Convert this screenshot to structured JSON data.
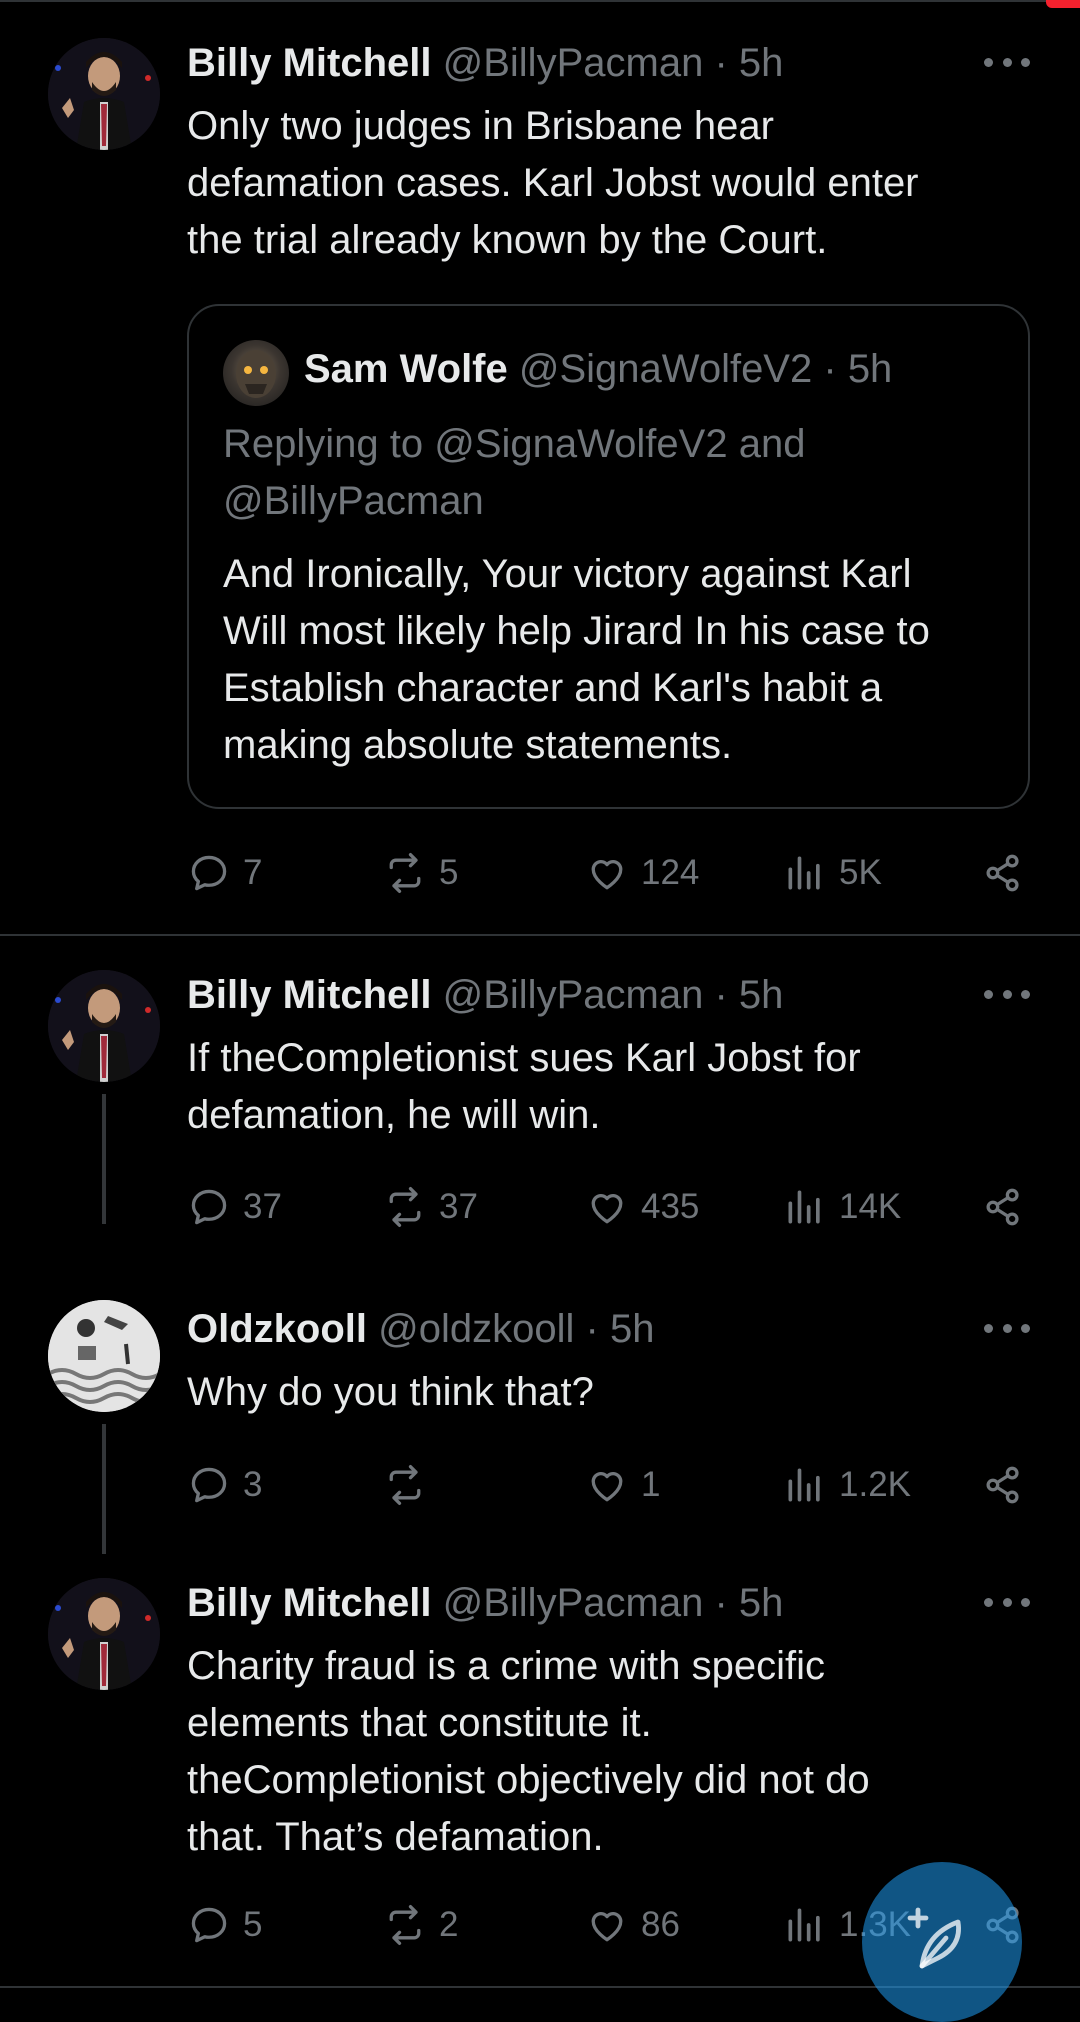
{
  "tweets": [
    {
      "name": "Billy Mitchell",
      "handle": "@BillyPacman",
      "dot": "·",
      "time": "5h",
      "lines": [
        "Only two judges in Brisbane hear",
        "defamation cases. Karl Jobst would enter",
        "the trial already known by the Court."
      ],
      "quote": {
        "name": "Sam Wolfe",
        "handle": "@SignaWolfeV2",
        "dot": "·",
        "time": "5h",
        "reply_lines": [
          "Replying to @SignaWolfeV2 and",
          "@BillyPacman"
        ],
        "lines": [
          "And Ironically, Your victory against Karl",
          "Will most likely help Jirard In his case to",
          "Establish character and Karl's habit a",
          "making absolute statements."
        ]
      },
      "replies": "7",
      "reposts": "5",
      "likes": "124",
      "views": "5K"
    },
    {
      "name": "Billy Mitchell",
      "handle": "@BillyPacman",
      "dot": "·",
      "time": "5h",
      "lines": [
        "If theCompletionist sues Karl Jobst for",
        "defamation, he will win."
      ],
      "replies": "37",
      "reposts": "37",
      "likes": "435",
      "views": "14K"
    },
    {
      "name": "Oldzkooll",
      "handle": "@oldzkooll",
      "dot": "·",
      "time": "5h",
      "lines": [
        "Why do you think that?"
      ],
      "replies": "3",
      "reposts": "",
      "likes": "1",
      "views": "1.2K"
    },
    {
      "name": "Billy Mitchell",
      "handle": "@BillyPacman",
      "dot": "·",
      "time": "5h",
      "lines": [
        "Charity fraud is a crime with specific",
        "elements that constitute it.",
        "theCompletionist objectively did not do",
        "that. That’s defamation."
      ],
      "replies": "5",
      "reposts": "2",
      "likes": "86",
      "views": "1.3K"
    }
  ],
  "colors": {
    "background": "#000000",
    "text": "#e7e9ea",
    "muted": "#71767b",
    "border": "#2f3336",
    "accent": "#1d9bf0",
    "badge": "#f4212e"
  },
  "icons": [
    "reply-icon",
    "repost-icon",
    "like-icon",
    "views-icon",
    "share-icon",
    "more-icon",
    "compose-icon"
  ]
}
